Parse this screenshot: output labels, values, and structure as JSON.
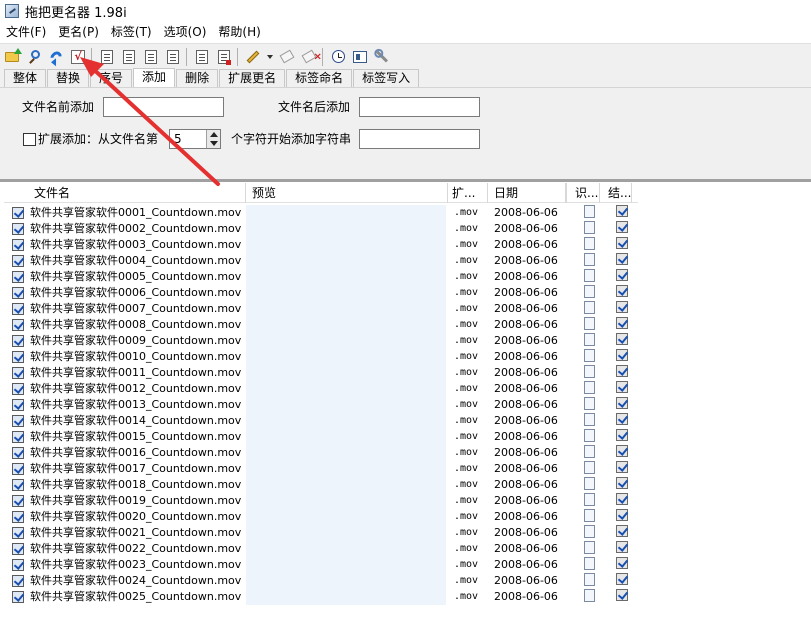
{
  "window": {
    "title": "拖把更名器 1.98i"
  },
  "menu": [
    {
      "label": "文件(F)"
    },
    {
      "label": "更名(P)"
    },
    {
      "label": "标签(T)"
    },
    {
      "label": "选项(O)"
    },
    {
      "label": "帮助(H)"
    }
  ],
  "toolbar": {
    "icons": [
      "open-folder-icon",
      "search-icon",
      "undo-icon",
      "check-icon",
      "doc-list-icon",
      "doc-list-icon",
      "doc-list-icon",
      "doc-list-icon",
      "doc-icon",
      "doc-red-icon",
      "pencil-icon",
      "dropdown-arrow-icon",
      "tag-icon",
      "tag-remove-icon",
      "clock-icon",
      "window-icon",
      "tools-icon"
    ],
    "check_glyph": "√"
  },
  "tabs": [
    {
      "label": "整体",
      "active": false
    },
    {
      "label": "替换",
      "active": false
    },
    {
      "label": "序号",
      "active": false
    },
    {
      "label": "添加",
      "active": true
    },
    {
      "label": "删除",
      "active": false
    },
    {
      "label": "扩展更名",
      "active": false
    },
    {
      "label": "标签命名",
      "active": false
    },
    {
      "label": "标签写入",
      "active": false
    }
  ],
  "add_panel": {
    "prefix_label": "文件名前添加",
    "prefix_value": "",
    "suffix_label": "文件名后添加",
    "suffix_value": "",
    "extend_label": "扩展添加：从文件名第",
    "extend_checked": false,
    "position_value": "5",
    "position_suffix": "个字符开始添加字符串",
    "insert_value": ""
  },
  "list": {
    "columns": [
      "文件名",
      "预览",
      "扩...",
      "日期",
      "识...",
      "结..."
    ],
    "rows": [
      {
        "name": "软件共享管家软件0001_Countdown.mov",
        "ext": ".mov",
        "date": "2008-06-06"
      },
      {
        "name": "软件共享管家软件0002_Countdown.mov",
        "ext": ".mov",
        "date": "2008-06-06"
      },
      {
        "name": "软件共享管家软件0003_Countdown.mov",
        "ext": ".mov",
        "date": "2008-06-06"
      },
      {
        "name": "软件共享管家软件0004_Countdown.mov",
        "ext": ".mov",
        "date": "2008-06-06"
      },
      {
        "name": "软件共享管家软件0005_Countdown.mov",
        "ext": ".mov",
        "date": "2008-06-06"
      },
      {
        "name": "软件共享管家软件0006_Countdown.mov",
        "ext": ".mov",
        "date": "2008-06-06"
      },
      {
        "name": "软件共享管家软件0007_Countdown.mov",
        "ext": ".mov",
        "date": "2008-06-06"
      },
      {
        "name": "软件共享管家软件0008_Countdown.mov",
        "ext": ".mov",
        "date": "2008-06-06"
      },
      {
        "name": "软件共享管家软件0009_Countdown.mov",
        "ext": ".mov",
        "date": "2008-06-06"
      },
      {
        "name": "软件共享管家软件0010_Countdown.mov",
        "ext": ".mov",
        "date": "2008-06-06"
      },
      {
        "name": "软件共享管家软件0011_Countdown.mov",
        "ext": ".mov",
        "date": "2008-06-06"
      },
      {
        "name": "软件共享管家软件0012_Countdown.mov",
        "ext": ".mov",
        "date": "2008-06-06"
      },
      {
        "name": "软件共享管家软件0013_Countdown.mov",
        "ext": ".mov",
        "date": "2008-06-06"
      },
      {
        "name": "软件共享管家软件0014_Countdown.mov",
        "ext": ".mov",
        "date": "2008-06-06"
      },
      {
        "name": "软件共享管家软件0015_Countdown.mov",
        "ext": ".mov",
        "date": "2008-06-06"
      },
      {
        "name": "软件共享管家软件0016_Countdown.mov",
        "ext": ".mov",
        "date": "2008-06-06"
      },
      {
        "name": "软件共享管家软件0017_Countdown.mov",
        "ext": ".mov",
        "date": "2008-06-06"
      },
      {
        "name": "软件共享管家软件0018_Countdown.mov",
        "ext": ".mov",
        "date": "2008-06-06"
      },
      {
        "name": "软件共享管家软件0019_Countdown.mov",
        "ext": ".mov",
        "date": "2008-06-06"
      },
      {
        "name": "软件共享管家软件0020_Countdown.mov",
        "ext": ".mov",
        "date": "2008-06-06"
      },
      {
        "name": "软件共享管家软件0021_Countdown.mov",
        "ext": ".mov",
        "date": "2008-06-06"
      },
      {
        "name": "软件共享管家软件0022_Countdown.mov",
        "ext": ".mov",
        "date": "2008-06-06"
      },
      {
        "name": "软件共享管家软件0023_Countdown.mov",
        "ext": ".mov",
        "date": "2008-06-06"
      },
      {
        "name": "软件共享管家软件0024_Countdown.mov",
        "ext": ".mov",
        "date": "2008-06-06"
      },
      {
        "name": "软件共享管家软件0025_Countdown.mov",
        "ext": ".mov",
        "date": "2008-06-06"
      }
    ]
  },
  "colors": {
    "annotation_arrow": "#e53030",
    "preview_bg": "#eef4fb",
    "panel_bg": "#f0f0f0"
  }
}
